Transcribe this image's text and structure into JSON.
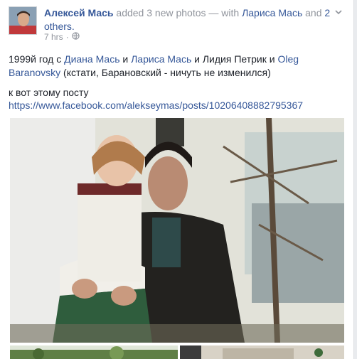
{
  "post": {
    "author": "Алексей Мась",
    "action_text": "added 3 new photos — with",
    "tagged_person": "Лариса Мась",
    "and_text": "and",
    "others": "2 others.",
    "time": "7 hrs",
    "separator": "·",
    "privacy_icon": "globe-icon",
    "menu_icon": "chevron-down-icon"
  },
  "content": {
    "p1_a": "1999й год с",
    "p1_b": "и",
    "p1_c": "и Лидия Петрик и",
    "p1_d": "(кстати, Барановский - ничуть не изменился)",
    "mention1": "Диана Мась",
    "mention2": "Лариса Мась",
    "mention3": "Oleg Baranovsky",
    "line2": "к вот этому посту",
    "url": "https://www.facebook.com/alekseymas/posts/10206408882795367"
  },
  "colors": {
    "link": "#365899",
    "meta": "#90949c",
    "text": "#1d2129"
  }
}
